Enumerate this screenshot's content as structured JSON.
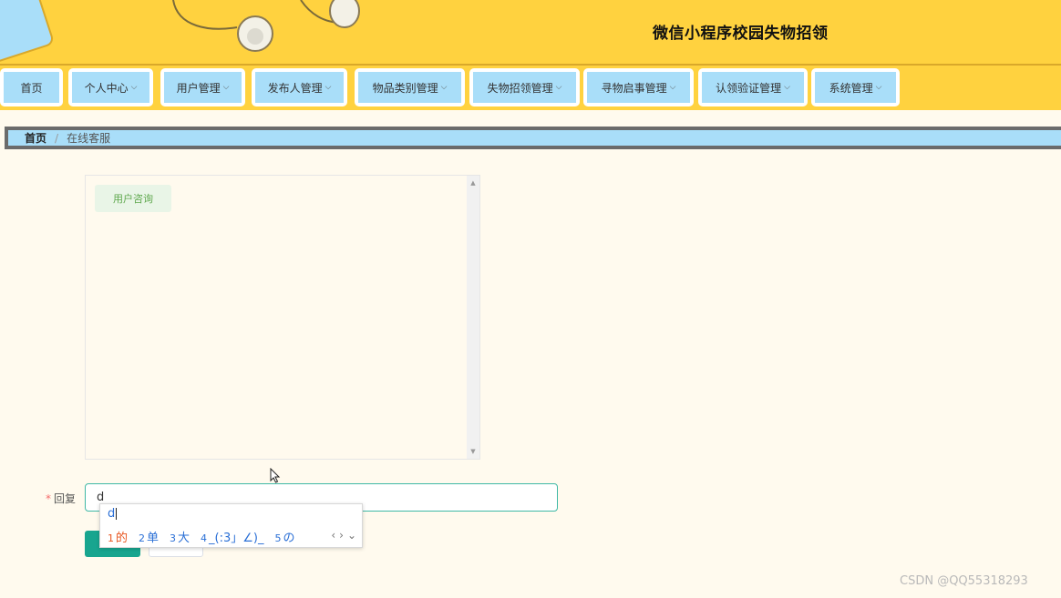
{
  "header": {
    "title": "微信小程序校园失物招领"
  },
  "nav": [
    {
      "label": "首页",
      "has_dropdown": false
    },
    {
      "label": "个人中心",
      "has_dropdown": true
    },
    {
      "label": "用户管理",
      "has_dropdown": true
    },
    {
      "label": "发布人管理",
      "has_dropdown": true
    },
    {
      "label": "物品类别管理",
      "has_dropdown": true
    },
    {
      "label": "失物招领管理",
      "has_dropdown": true
    },
    {
      "label": "寻物启事管理",
      "has_dropdown": true
    },
    {
      "label": "认领验证管理",
      "has_dropdown": true
    },
    {
      "label": "系统管理",
      "has_dropdown": true
    }
  ],
  "breadcrumb": {
    "home": "首页",
    "separator": "/",
    "current": "在线客服"
  },
  "chat": {
    "messages": [
      {
        "text": "用户咨询"
      }
    ]
  },
  "reply": {
    "required_mark": "*",
    "label": "回复",
    "value": "d"
  },
  "ime": {
    "composition": "d",
    "candidates": [
      {
        "num": "1",
        "text": "的"
      },
      {
        "num": "2",
        "text": "单"
      },
      {
        "num": "3",
        "text": "大"
      },
      {
        "num": "4",
        "text": "_(:3」∠)_"
      },
      {
        "num": "5",
        "text": "の"
      }
    ],
    "controls": {
      "prev": "‹",
      "next": "›",
      "expand": "⌄"
    }
  },
  "watermark": "CSDN @QQ55318293",
  "colors": {
    "header_bg": "#ffd23f",
    "nav_item_bg": "#a9def9",
    "page_bg": "#fffaee",
    "primary": "#18a58f"
  }
}
